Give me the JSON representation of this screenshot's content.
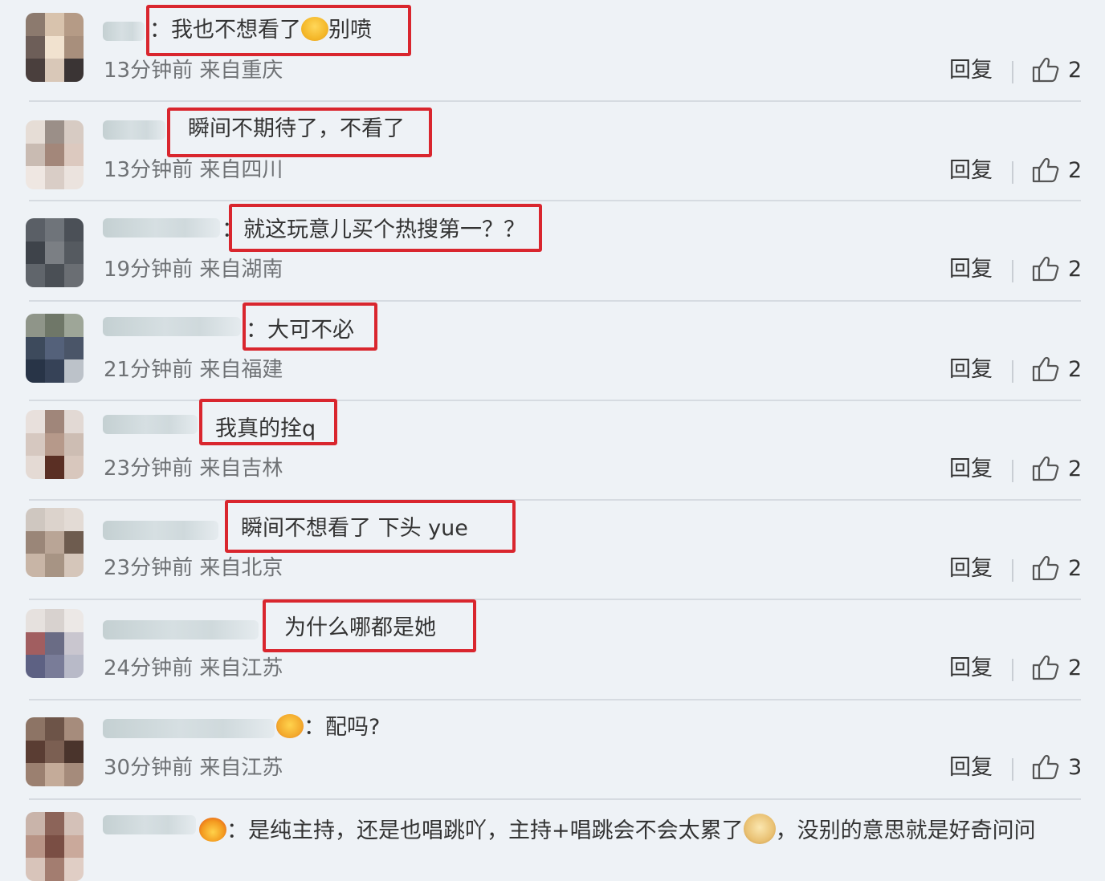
{
  "ui": {
    "reply_label": "回复",
    "like_icon": "thumbs-up-icon",
    "highlight_color": "#d9262e",
    "background": "#eef2f6"
  },
  "comments": [
    {
      "text": "：我也不想看了",
      "text_tail": "别喷",
      "emoji_mid": "crying-laugh-emoji",
      "time": "13分钟前",
      "location": "来自重庆",
      "meta": "13分钟前 来自重庆",
      "likes": "2"
    },
    {
      "text": "瞬间不期待了，不看了",
      "time": "13分钟前",
      "location": "来自四川",
      "meta": "13分钟前 来自四川",
      "likes": "2"
    },
    {
      "text": "：就这玩意儿买个热搜第一？？",
      "time": "19分钟前",
      "location": "来自湖南",
      "meta": "19分钟前 来自湖南",
      "likes": "2"
    },
    {
      "text": "：大可不必",
      "time": "21分钟前",
      "location": "来自福建",
      "meta": "21分钟前 来自福建",
      "likes": "2"
    },
    {
      "text": "我真的拴q",
      "time": "23分钟前",
      "location": "来自吉林",
      "meta": "23分钟前 来自吉林",
      "likes": "2"
    },
    {
      "text": "瞬间不想看了 下头 yue",
      "time": "23分钟前",
      "location": "来自北京",
      "meta": "23分钟前 来自北京",
      "likes": "2"
    },
    {
      "text": "为什么哪都是她",
      "time": "24分钟前",
      "location": "来自江苏",
      "meta": "24分钟前 来自江苏",
      "likes": "2"
    },
    {
      "text": "：配吗?",
      "emoji_lead": "love-eyes-emoji",
      "time": "30分钟前",
      "location": "来自江苏",
      "meta": "30分钟前 来自江苏",
      "likes": "3"
    },
    {
      "text": "：是纯主持，还是也唱跳吖，主持+唱跳会不会太累了",
      "text_tail": "，没别的意思就是好奇问问",
      "emoji_lead": "fire-emoji",
      "emoji_mid": "doge-emoji"
    }
  ]
}
